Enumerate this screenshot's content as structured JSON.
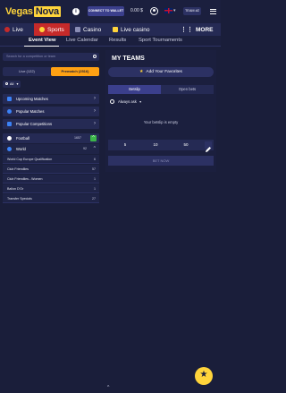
{
  "header": {
    "logo_part1": "Vegas",
    "logo_part2": "Nova",
    "info_glyph": "i",
    "wallet_label": "CONNECT TO WALLET",
    "balance": "0.00 $",
    "team_label": "TEAM #Z"
  },
  "nav_main": {
    "items": [
      {
        "label": "Live",
        "icon": "live-dot-icon"
      },
      {
        "label": "Sports",
        "icon": "sports-ball-icon"
      },
      {
        "label": "Casino",
        "icon": "casino-icon"
      },
      {
        "label": "Live casino",
        "icon": "live-casino-icon"
      }
    ],
    "more_label": "MORE"
  },
  "nav_sub": {
    "items": [
      "Event View",
      "Live Calendar",
      "Results",
      "Sport Tournaments"
    ]
  },
  "left": {
    "search_placeholder": "Search for a competition or team",
    "tab_live": "Live (122)",
    "tab_prematch": "Prematch (2516)",
    "all_label": "All",
    "rows": [
      {
        "label": "Upcoming Matches"
      },
      {
        "label": "Popular Matches"
      },
      {
        "label": "Popular Competitions"
      }
    ],
    "football": {
      "label": "Football",
      "count": "1657"
    },
    "world": {
      "label": "World",
      "count": "92"
    },
    "subs": [
      {
        "label": "World Cup Europe Qualification",
        "count": "6"
      },
      {
        "label": "Club Friendlies",
        "count": "57"
      },
      {
        "label": "Club Friendlies - Women",
        "count": "1"
      },
      {
        "label": "Ballon D'Or",
        "count": "1"
      },
      {
        "label": "Transfer Specials",
        "count": "27"
      }
    ]
  },
  "right": {
    "title": "MY TEAMS",
    "fav_label": "Add Your Favorites",
    "tab_betslip": "Betslip",
    "tab_open": "Open bets",
    "always_label": "Always ask",
    "empty_text": "Your betslip is empty",
    "stakes": [
      "5",
      "10",
      "50"
    ],
    "bet_now": "BET NOW"
  },
  "colors": {
    "bg": "#1a1e3a",
    "accent_yellow": "#ffd43b",
    "prematch_orange": "#ffa113",
    "sports_red": "#c62a2a",
    "green_badge": "#3bb54a"
  }
}
